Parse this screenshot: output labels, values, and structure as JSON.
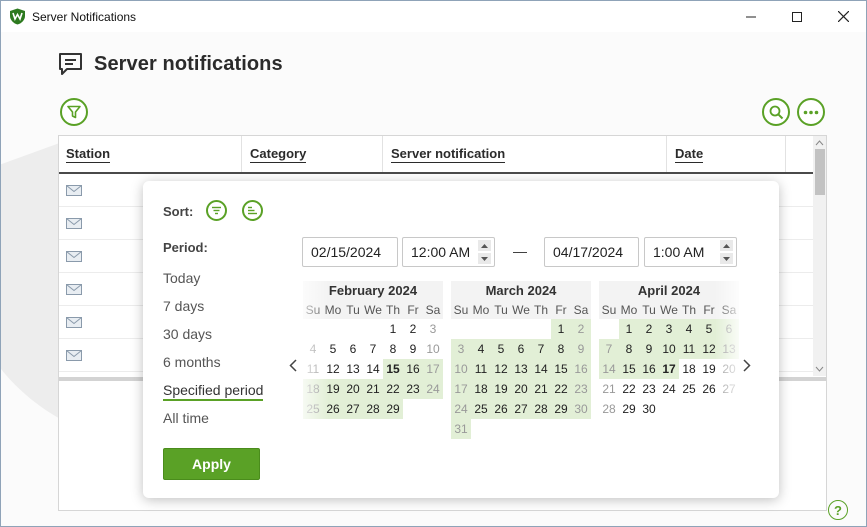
{
  "window": {
    "title": "Server Notifications"
  },
  "page": {
    "title": "Server notifications"
  },
  "table": {
    "columns": [
      "Station",
      "Category",
      "Server notification",
      "Date"
    ],
    "row_count": 6
  },
  "popup": {
    "sort_label": "Sort:",
    "period_label": "Period:",
    "periods": [
      "Today",
      "7 days",
      "30 days",
      "6 months",
      "Specified period",
      "All time"
    ],
    "active_period": "Specified period",
    "from_date": "02/15/2024",
    "from_time": "12:00 AM",
    "to_date": "04/17/2024",
    "to_time": "1:00 AM",
    "separator": "—",
    "apply_label": "Apply",
    "weekdays": [
      "Su",
      "Mo",
      "Tu",
      "We",
      "Th",
      "Fr",
      "Sa"
    ],
    "calendars": [
      {
        "title": "February 2024",
        "weeks": [
          [
            "",
            "",
            "",
            "",
            "1",
            "2",
            "3"
          ],
          [
            "4",
            "5",
            "6",
            "7",
            "8",
            "9",
            "10"
          ],
          [
            "11",
            "12",
            "13",
            "14",
            "15",
            "16",
            "17"
          ],
          [
            "18",
            "19",
            "20",
            "21",
            "22",
            "23",
            "24"
          ],
          [
            "25",
            "26",
            "27",
            "28",
            "29",
            "",
            ""
          ]
        ]
      },
      {
        "title": "March 2024",
        "weeks": [
          [
            "",
            "",
            "",
            "",
            "",
            "1",
            "2"
          ],
          [
            "3",
            "4",
            "5",
            "6",
            "7",
            "8",
            "9"
          ],
          [
            "10",
            "11",
            "12",
            "13",
            "14",
            "15",
            "16"
          ],
          [
            "17",
            "18",
            "19",
            "20",
            "21",
            "22",
            "23"
          ],
          [
            "24",
            "25",
            "26",
            "27",
            "28",
            "29",
            "30"
          ],
          [
            "31",
            "",
            "",
            "",
            "",
            "",
            ""
          ]
        ]
      },
      {
        "title": "April 2024",
        "weeks": [
          [
            "",
            "1",
            "2",
            "3",
            "4",
            "5",
            "6"
          ],
          [
            "7",
            "8",
            "9",
            "10",
            "11",
            "12",
            "13"
          ],
          [
            "14",
            "15",
            "16",
            "17",
            "18",
            "19",
            "20"
          ],
          [
            "21",
            "22",
            "23",
            "24",
            "25",
            "26",
            "27"
          ],
          [
            "28",
            "29",
            "30",
            "",
            "",
            "",
            ""
          ]
        ]
      }
    ],
    "range_start": "February 15, 2024",
    "range_end": "April 17, 2024"
  },
  "help_label": "?",
  "colors": {
    "accent": "#5aa126",
    "range": "#e2efd6"
  }
}
